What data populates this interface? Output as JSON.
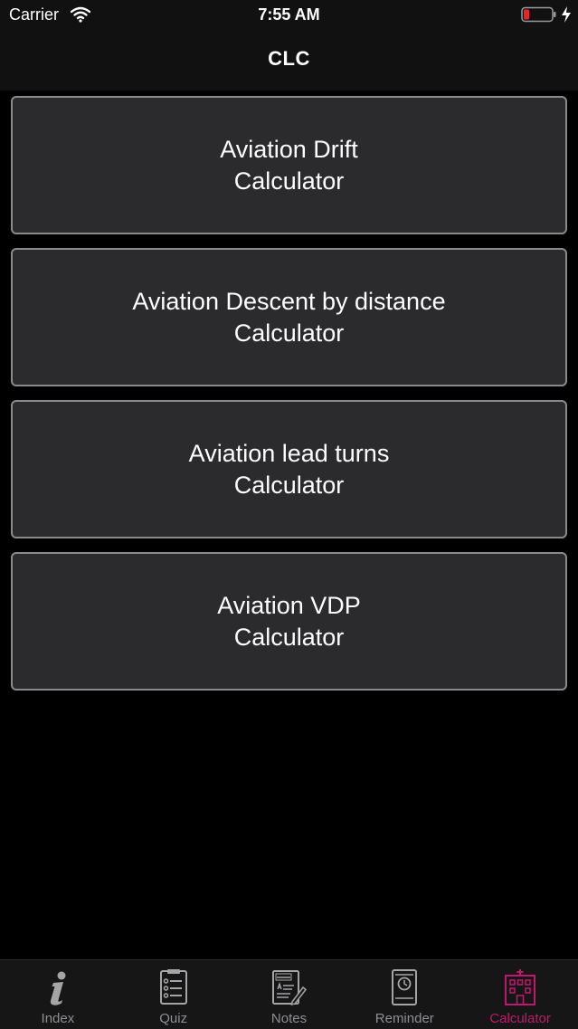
{
  "status_bar": {
    "carrier": "Carrier",
    "time": "7:55 AM",
    "battery_color": "#e0262b"
  },
  "nav": {
    "title": "CLC"
  },
  "calculators": [
    {
      "line1": "Aviation Drift",
      "line2": "Calculator"
    },
    {
      "line1": "Aviation Descent by distance",
      "line2": "Calculator"
    },
    {
      "line1": "Aviation lead turns",
      "line2": "Calculator"
    },
    {
      "line1": "Aviation VDP",
      "line2": "Calculator"
    }
  ],
  "tabs": [
    {
      "label": "Index",
      "icon": "info-icon",
      "active": false
    },
    {
      "label": "Quiz",
      "icon": "clipboard-icon",
      "active": false
    },
    {
      "label": "Notes",
      "icon": "notes-icon",
      "active": false
    },
    {
      "label": "Reminder",
      "icon": "reminder-icon",
      "active": false
    },
    {
      "label": "Calculator",
      "icon": "calculator-building-icon",
      "active": true
    }
  ],
  "colors": {
    "accent": "#c0186d",
    "button_bg": "#2b2a2d",
    "button_border": "#8a8a8c",
    "inactive_tab": "#8e8e93"
  }
}
